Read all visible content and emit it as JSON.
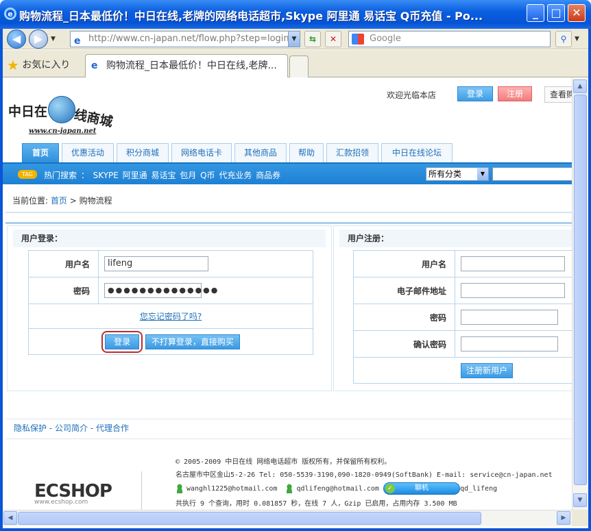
{
  "window": {
    "title": "购物流程_日本最低价！中日在线,老牌的网络电话超市,Skype 阿里通 易话宝 Q币充值 - Po...",
    "minimize": "_",
    "maximize": "□",
    "close": "✕"
  },
  "toolbar": {
    "address": "http://www.cn-japan.net/flow.php?step=login",
    "search_placeholder": "Google"
  },
  "favorites": {
    "label": "お気に入り",
    "tab_title": "购物流程_日本最低价！中日在线,老牌..."
  },
  "header": {
    "logo_text_left": "中日在",
    "logo_text_right": "线商城",
    "logo_url": "www.cn-japan.net",
    "welcome": "欢迎光临本店",
    "login": "登录",
    "register": "注册",
    "view_cart": "查看购物车"
  },
  "nav": {
    "items": [
      "首页",
      "优惠活动",
      "积分商城",
      "网络电话卡",
      "其他商品",
      "帮助",
      "汇款招领",
      "中日在线论坛"
    ]
  },
  "hotbar": {
    "tag": "TAG",
    "text": "热门搜索 ： SKYPE 阿里通 易话宝 包月 Q币 代充业务 商品券",
    "category": "所有分类"
  },
  "breadcrumb": {
    "prefix": "当前位置:",
    "home": "首页",
    "sep": ">",
    "current": "购物流程"
  },
  "login": {
    "heading": "用户登录：",
    "username_label": "用户名",
    "username_value": "lifeng",
    "password_label": "密码",
    "password_value": "●●●●●●●●●●●●●●",
    "forgot": "您忘记密码了吗?",
    "submit": "登录",
    "skip": "不打算登录，直接购买"
  },
  "register": {
    "heading": "用户注册：",
    "username_label": "用户名",
    "email_label": "电子邮件地址",
    "password_label": "密码",
    "confirm_label": "确认密码",
    "submit": "注册新用户"
  },
  "footer": {
    "links": [
      "隐私保护",
      "公司简介",
      "代理合作"
    ],
    "sep": "-",
    "brand": "ECSHOP",
    "brand_sub": "www.ecshop.com",
    "copyright": "© 2005-2009 中日在线 网络电话超市 版权所有，并保留所有权利。",
    "address": "名古屋市中区金山5-2-26 Tel: 050-5539-3190,090-1820-0949(SoftBank) E-mail: service@cn-japan.net",
    "msn1": "wanghl1225@hotmail.com",
    "msn2": "qdlifeng@hotmail.com",
    "chat": "聊机",
    "qq": "qd_lifeng",
    "stats": "共执行 9 个查询，用时 0.081857 秒，在线 7 人，Gzip 已启用，占用内存 3.500 MB"
  }
}
